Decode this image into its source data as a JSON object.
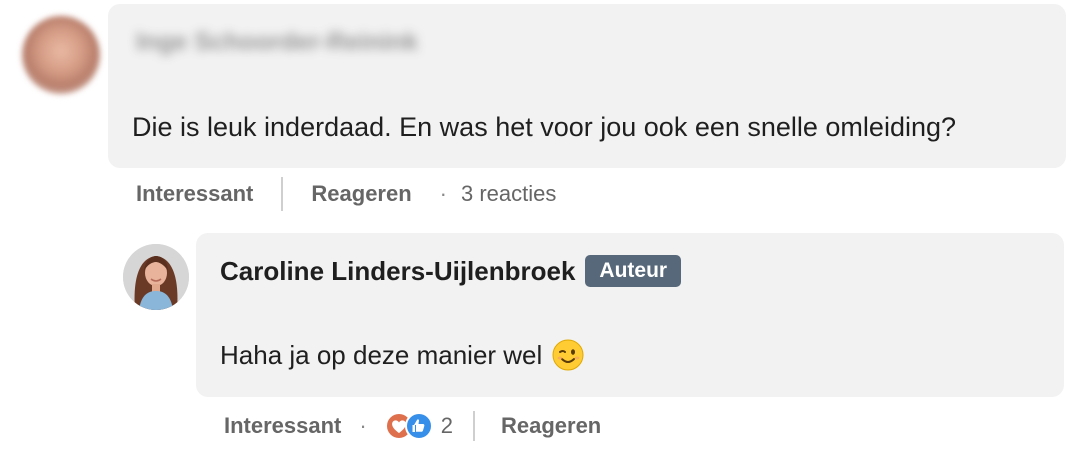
{
  "comment": {
    "author": "Inge Schoorder-Reinink",
    "text": "Die is leuk inderdaad. En was het voor jou ook een snelle omleiding?",
    "actions": {
      "interesting_label": "Interessant",
      "reply_label": "Reageren",
      "separator": "·",
      "reply_count_text": "3 reacties"
    }
  },
  "reply": {
    "author": "Caroline Linders-Uijlenbroek",
    "badge": "Auteur",
    "text": "Haha ja op deze manier wel",
    "emoji_icon": "winking-face-icon",
    "actions": {
      "interesting_label": "Interessant",
      "separator": "·",
      "reaction_icons": [
        "love-reaction-icon",
        "like-reaction-icon"
      ],
      "reaction_count": "2",
      "reply_label": "Reageren"
    }
  },
  "colors": {
    "bubble_bg": "#f2f2f2",
    "badge_bg": "#56687a",
    "love": "#df704d",
    "like": "#378fe9",
    "muted_text": "#666666"
  }
}
